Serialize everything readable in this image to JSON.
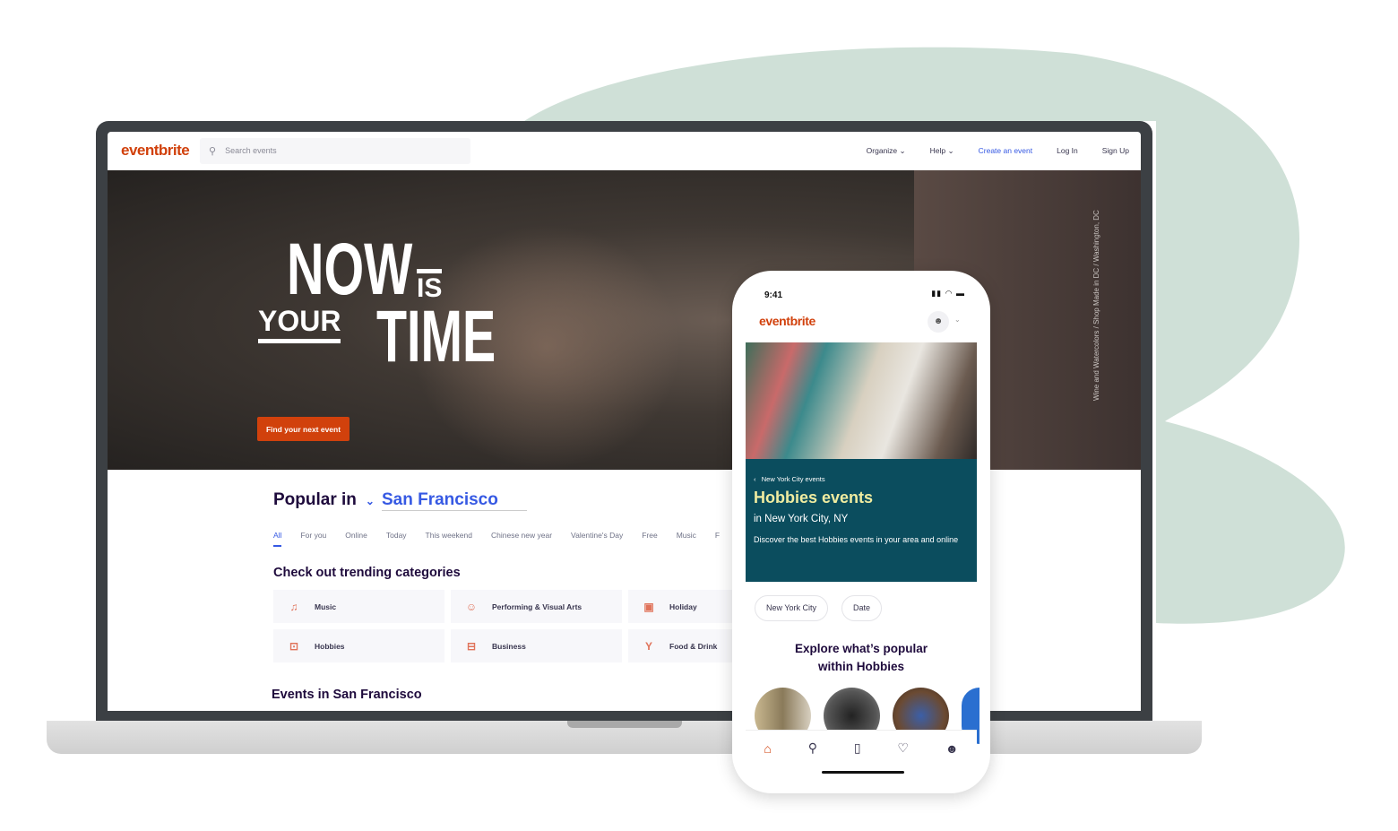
{
  "colors": {
    "brand": "#d1410c",
    "link": "#3659e3",
    "blob": "#cfe0d7",
    "teal": "#0b4d5e"
  },
  "desktop": {
    "logo": "eventbrite",
    "search_placeholder": "Search events",
    "nav": {
      "organize": "Organize",
      "help": "Help",
      "create": "Create an event",
      "login": "Log In",
      "signup": "Sign Up"
    },
    "hero": {
      "line1": "NOW",
      "line2": "IS",
      "line3": "YOUR",
      "line4": "TIME",
      "cta": "Find your next event",
      "credit": "Wine and Watercolors / Shop Made in DC / Washington, DC"
    },
    "popular_label": "Popular in",
    "city": "San Francisco",
    "tabs": [
      "All",
      "For you",
      "Online",
      "Today",
      "This weekend",
      "Chinese new year",
      "Valentine's Day",
      "Free",
      "Music",
      "F"
    ],
    "trending_title": "Check out trending categories",
    "categories": [
      {
        "label": "Music",
        "icon": "music-note-icon"
      },
      {
        "label": "Performing & Visual Arts",
        "icon": "theater-mask-icon"
      },
      {
        "label": "Holiday",
        "icon": "photo-icon"
      },
      {
        "label": "Hobbies",
        "icon": "gamepad-icon"
      },
      {
        "label": "Business",
        "icon": "briefcase-icon"
      },
      {
        "label": "Food & Drink",
        "icon": "cocktail-icon"
      }
    ],
    "events_title": "Events in San Francisco"
  },
  "mobile": {
    "time": "9:41",
    "logo": "eventbrite",
    "breadcrumb": "New York City events",
    "title": "Hobbies events",
    "subtitle": "in New York City, NY",
    "description": "Discover the best Hobbies events in your area and online",
    "filters": [
      "New York City",
      "Date"
    ],
    "explore": "Explore what’s popular within Hobbies",
    "tabbar": [
      "home-icon",
      "search-icon",
      "ticket-icon",
      "heart-icon",
      "profile-icon"
    ]
  }
}
